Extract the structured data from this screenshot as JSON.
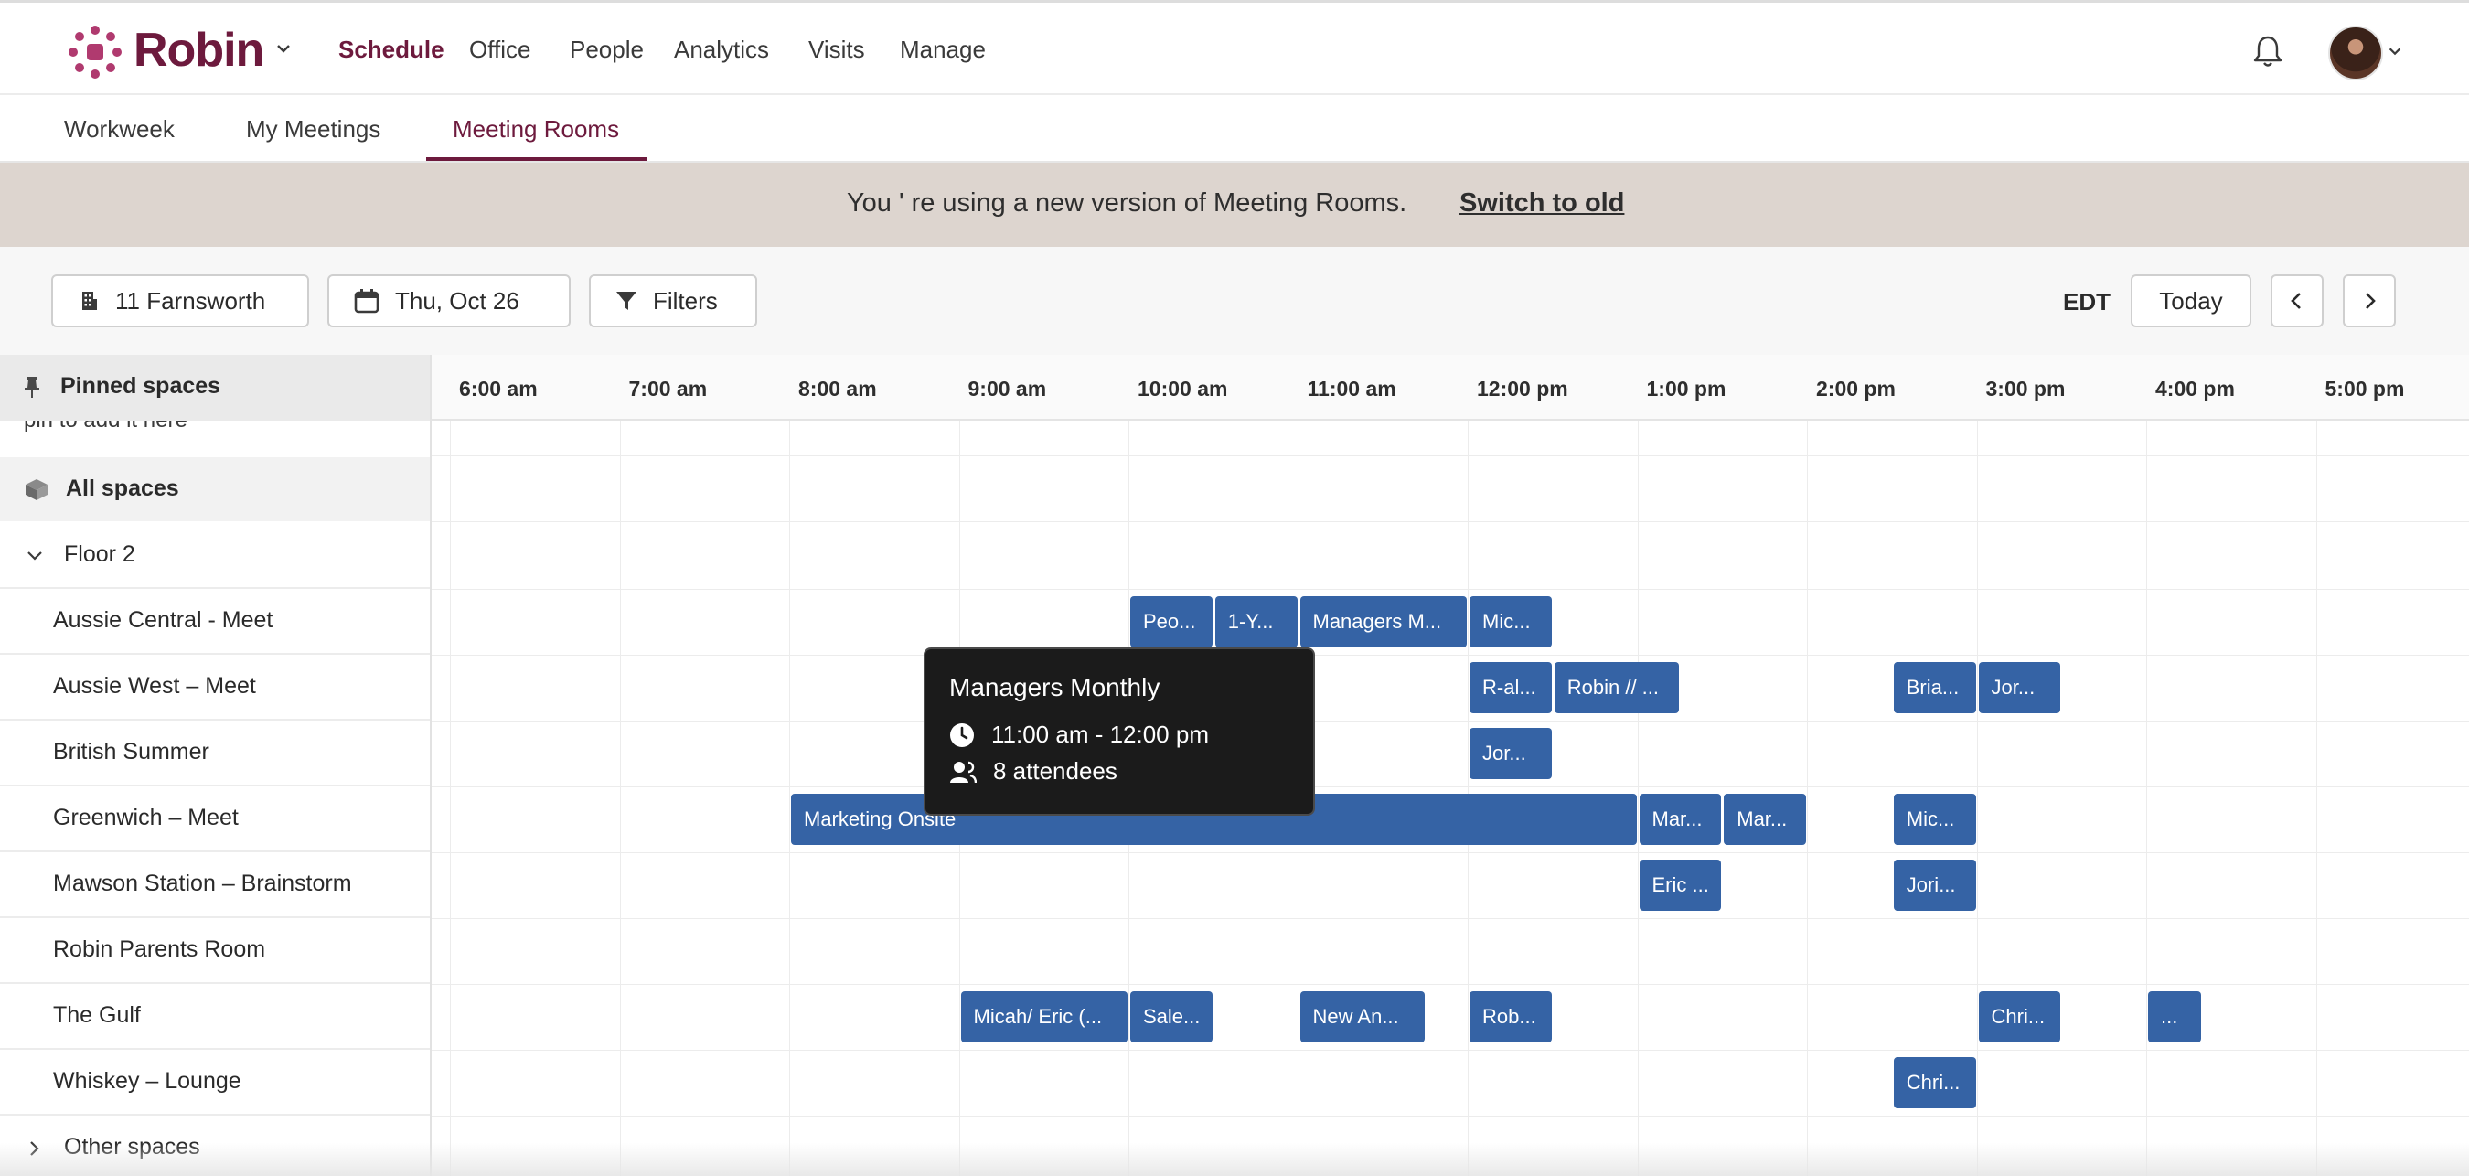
{
  "app": {
    "brand": "Robin"
  },
  "nav": {
    "items": [
      "Schedule",
      "Office",
      "People",
      "Analytics",
      "Visits",
      "Manage"
    ],
    "active": "Schedule"
  },
  "tabs": {
    "items": [
      "Workweek",
      "My Meetings",
      "Meeting Rooms"
    ],
    "active": "Meeting Rooms"
  },
  "banner": {
    "text": "You ' re using a new version of Meeting Rooms.",
    "link": "Switch to old"
  },
  "toolbar": {
    "location": "11 Farnsworth",
    "date": "Thu, Oct 26",
    "filters": "Filters",
    "timezone": "EDT",
    "today": "Today"
  },
  "sidebar": {
    "pinned_label": "Pinned spaces",
    "pinned_hint": "pin to add it here",
    "all_spaces": "All spaces",
    "floor": "Floor 2",
    "rooms": [
      "Aussie Central - Meet",
      "Aussie West – Meet",
      "British Summer",
      "Greenwich – Meet",
      "Mawson Station – Brainstorm",
      "Robin Parents Room",
      "The Gulf",
      "Whiskey – Lounge"
    ],
    "other_spaces": "Other spaces"
  },
  "timeline": {
    "hours": [
      "6:00 am",
      "7:00 am",
      "8:00 am",
      "9:00 am",
      "10:00 am",
      "11:00 am",
      "12:00 pm",
      "1:00 pm",
      "2:00 pm",
      "3:00 pm",
      "4:00 pm",
      "5:00 pm"
    ],
    "events": [
      {
        "room": 0,
        "start": 10.0,
        "end": 10.5,
        "label": "Peo..."
      },
      {
        "room": 0,
        "start": 10.5,
        "end": 11.0,
        "label": "1-Y..."
      },
      {
        "room": 0,
        "start": 11.0,
        "end": 12.0,
        "label": "Managers M..."
      },
      {
        "room": 0,
        "start": 12.0,
        "end": 12.5,
        "label": "Mic..."
      },
      {
        "room": 1,
        "start": 12.0,
        "end": 12.5,
        "label": "R-al..."
      },
      {
        "room": 1,
        "start": 12.5,
        "end": 13.25,
        "label": "Robin // ..."
      },
      {
        "room": 1,
        "start": 14.5,
        "end": 15.0,
        "label": "Bria..."
      },
      {
        "room": 1,
        "start": 15.0,
        "end": 15.5,
        "label": "Jor..."
      },
      {
        "room": 2,
        "start": 12.0,
        "end": 12.5,
        "label": "Jor..."
      },
      {
        "room": 3,
        "start": 8.0,
        "end": 13.0,
        "label": "Marketing Onsite"
      },
      {
        "room": 3,
        "start": 13.0,
        "end": 13.5,
        "label": "Mar..."
      },
      {
        "room": 3,
        "start": 13.5,
        "end": 14.0,
        "label": "Mar..."
      },
      {
        "room": 3,
        "start": 14.5,
        "end": 15.0,
        "label": "Mic..."
      },
      {
        "room": 4,
        "start": 13.0,
        "end": 13.5,
        "label": "Eric ..."
      },
      {
        "room": 4,
        "start": 14.5,
        "end": 15.0,
        "label": "Jori..."
      },
      {
        "room": 6,
        "start": 9.0,
        "end": 10.0,
        "label": "Micah/ Eric (..."
      },
      {
        "room": 6,
        "start": 10.0,
        "end": 10.5,
        "label": "Sale..."
      },
      {
        "room": 6,
        "start": 11.0,
        "end": 11.75,
        "label": "New An..."
      },
      {
        "room": 6,
        "start": 12.0,
        "end": 12.5,
        "label": "Rob..."
      },
      {
        "room": 6,
        "start": 15.0,
        "end": 15.5,
        "label": "Chri..."
      },
      {
        "room": 6,
        "start": 16.0,
        "end": 16.33,
        "label": "..."
      },
      {
        "room": 7,
        "start": 14.5,
        "end": 15.0,
        "label": "Chri..."
      }
    ]
  },
  "tooltip": {
    "title": "Managers Monthly",
    "time": "11:00 am - 12:00 pm",
    "attendees": "8 attendees"
  },
  "colors": {
    "brand": "#6d1a3d",
    "event": "#3563a5",
    "banner": "#ddd5cf",
    "tooltip": "#1b1b1b"
  }
}
